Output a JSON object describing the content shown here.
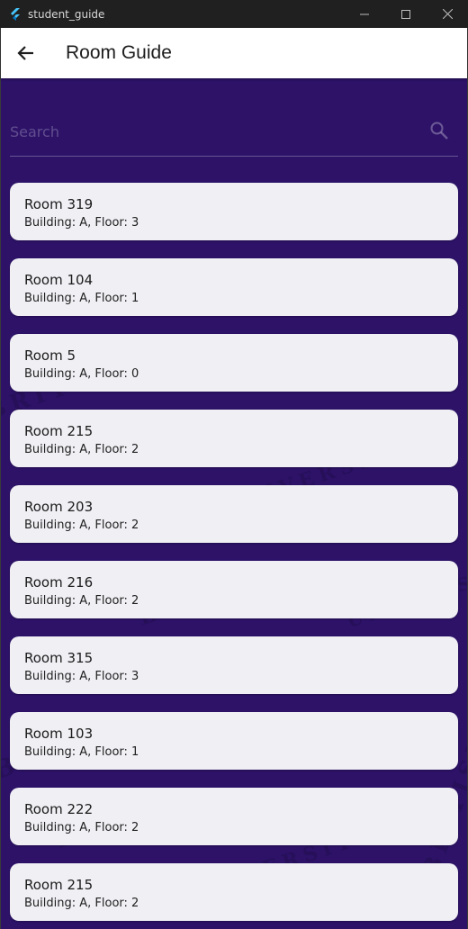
{
  "window": {
    "title": "student_guide",
    "icon": "flutter-icon"
  },
  "appbar": {
    "title": "Room Guide",
    "back_icon": "arrow-left-icon"
  },
  "search": {
    "placeholder": "Search",
    "value": "",
    "icon": "search-icon"
  },
  "rooms": [
    {
      "name": "Room 319",
      "info": "Building: A, Floor: 3"
    },
    {
      "name": "Room 104",
      "info": "Building: A, Floor: 1"
    },
    {
      "name": "Room 5",
      "info": "Building: A, Floor: 0"
    },
    {
      "name": "Room 215",
      "info": "Building: A, Floor: 2"
    },
    {
      "name": "Room 203",
      "info": "Building: A, Floor: 2"
    },
    {
      "name": "Room 216",
      "info": "Building: A, Floor: 2"
    },
    {
      "name": "Room 315",
      "info": "Building: A, Floor: 3"
    },
    {
      "name": "Room 103",
      "info": "Building: A, Floor: 1"
    },
    {
      "name": "Room 222",
      "info": "Building: A, Floor: 2"
    },
    {
      "name": "Room 215",
      "info": "Building: A, Floor: 2"
    }
  ],
  "colors": {
    "background": "#2d1268",
    "card": "#efeff4",
    "titlebar": "#202020"
  },
  "watermark": [
    "BRITISH",
    "UNIVERSITY",
    "EGYPT",
    "BSU",
    "BRITISH",
    "UNIVERSITY",
    "EGYPT",
    "BRITISH",
    "UNIVERSITY"
  ]
}
